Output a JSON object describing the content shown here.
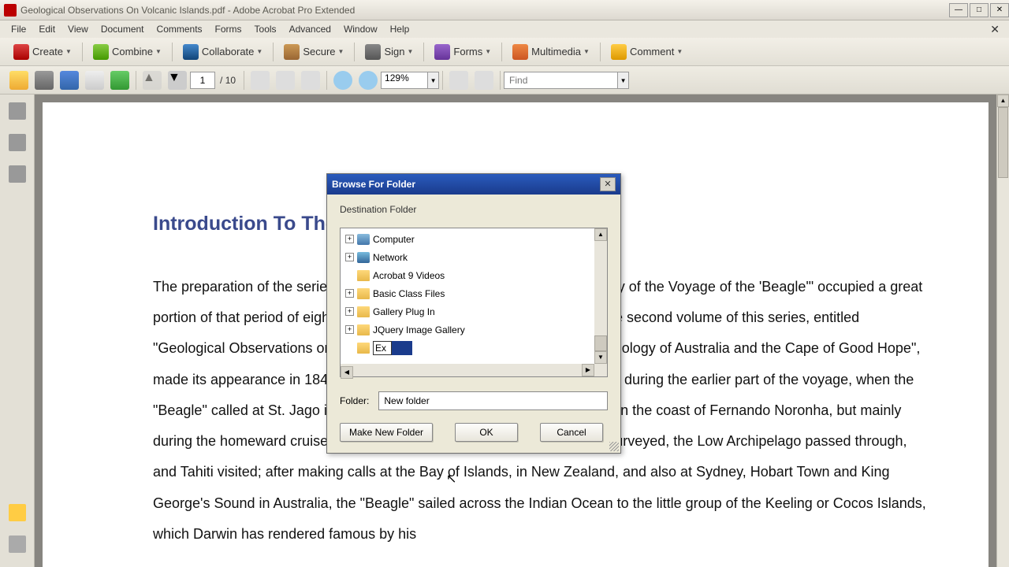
{
  "window": {
    "title": "Geological Observations On Volcanic Islands.pdf - Adobe Acrobat Pro Extended"
  },
  "menubar": {
    "items": [
      "File",
      "Edit",
      "View",
      "Document",
      "Comments",
      "Forms",
      "Tools",
      "Advanced",
      "Window",
      "Help"
    ]
  },
  "toolbar1": {
    "create": "Create",
    "combine": "Combine",
    "collaborate": "Collaborate",
    "secure": "Secure",
    "sign": "Sign",
    "forms": "Forms",
    "multimedia": "Multimedia",
    "comment": "Comment"
  },
  "toolbar2": {
    "page_current": "1",
    "page_sep": "/",
    "page_total": "10",
    "zoom": "129%",
    "find_placeholder": "Find"
  },
  "document": {
    "heading": "Introduction To The",
    "body": "The preparation of the series of volumes, bearing the general title \"Geology of the Voyage of the 'Beagle'\" occupied a great portion of that period of eight years that followed his return to England. The second volume of this series, entitled \"Geological Observations on Volcanic Islands, with Brief Notices on the Geology of Australia and the Cape of Good Hope\", made its appearance in 1844. The materials for this volume were collected during the earlier part of the voyage, when the \"Beagle\" called at St. Jago in the Cape de Verde group, at several points on the coast of Fernando Noronha, but mainly during the homeward cruise; the principal localities at which Darwin was surveyed, the Low Archipelago passed through, and Tahiti visited; after making calls at the Bay of Islands, in New Zealand, and also at Sydney, Hobart Town and King George's Sound in Australia, the \"Beagle\" sailed across the Indian Ocean to the little group of the Keeling or Cocos Islands, which Darwin has rendered famous by his"
  },
  "dialog": {
    "title": "Browse For Folder",
    "label": "Destination Folder",
    "tree": [
      {
        "expandable": true,
        "icon": "computer",
        "label": "Computer"
      },
      {
        "expandable": true,
        "icon": "network",
        "label": "Network"
      },
      {
        "expandable": false,
        "icon": "folder",
        "label": "Acrobat 9 Videos"
      },
      {
        "expandable": true,
        "icon": "folder",
        "label": "Basic Class Files"
      },
      {
        "expandable": true,
        "icon": "folder",
        "label": "Gallery Plug In"
      },
      {
        "expandable": true,
        "icon": "folder",
        "label": "JQuery Image Gallery"
      }
    ],
    "editing_value": "Ex",
    "folder_label": "Folder:",
    "folder_value": "New folder",
    "btn_make": "Make New Folder",
    "btn_ok": "OK",
    "btn_cancel": "Cancel"
  }
}
